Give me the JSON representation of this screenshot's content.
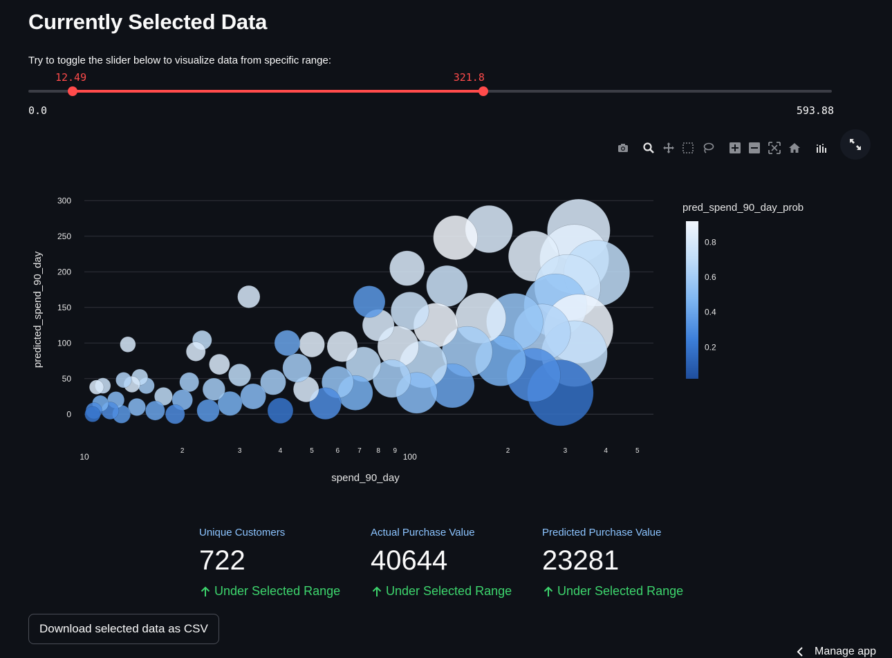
{
  "page": {
    "title": "Currently Selected Data",
    "instruction": "Try to toggle the slider below to visualize data from specific range:"
  },
  "slider": {
    "min": 0.0,
    "max": 593.88,
    "min_label": "0.0",
    "max_label": "593.88",
    "low": 12.49,
    "high": 321.8,
    "low_label": "12.49",
    "high_label": "321.8",
    "accent": "#ff4b4b"
  },
  "modebar": {
    "icons": [
      "camera-icon",
      "zoom-icon",
      "pan-icon",
      "box-select-icon",
      "lasso-select-icon",
      "zoom-in-icon",
      "zoom-out-icon",
      "autoscale-icon",
      "reset-axes-icon",
      "plotly-logo-icon"
    ],
    "fullscreen_icon": "expand-icon"
  },
  "chart_data": {
    "type": "scatter",
    "subtype": "bubble",
    "xlabel": "spend_90_day",
    "ylabel": "predicted_spend_90_day",
    "x_scale": "log",
    "xlim": [
      10,
      560
    ],
    "ylim": [
      -25,
      310
    ],
    "x_ticks_major": [
      {
        "value": 10,
        "label": "10"
      },
      {
        "value": 100,
        "label": "100"
      }
    ],
    "x_ticks_minor": [
      {
        "value": 20,
        "label": "2"
      },
      {
        "value": 30,
        "label": "3"
      },
      {
        "value": 40,
        "label": "4"
      },
      {
        "value": 50,
        "label": "5"
      },
      {
        "value": 60,
        "label": "6"
      },
      {
        "value": 70,
        "label": "7"
      },
      {
        "value": 80,
        "label": "8"
      },
      {
        "value": 90,
        "label": "9"
      },
      {
        "value": 200,
        "label": "2"
      },
      {
        "value": 300,
        "label": "3"
      },
      {
        "value": 400,
        "label": "4"
      },
      {
        "value": 500,
        "label": "5"
      }
    ],
    "y_ticks": [
      0,
      50,
      100,
      150,
      200,
      250,
      300
    ],
    "grid": true,
    "colorbar": {
      "title": "pred_spend_90_day_prob",
      "ticks": [
        0.2,
        0.4,
        0.6,
        0.8
      ],
      "range": [
        0.02,
        0.92
      ],
      "colors": [
        "#1f4e9c",
        "#3d7fd9",
        "#7eb6f2",
        "#bfdcf8",
        "#f2f7fd"
      ]
    },
    "points": [
      {
        "x": 330,
        "y": 258,
        "p": 0.82,
        "s": 0.9
      },
      {
        "x": 320,
        "y": 218,
        "p": 0.85,
        "s": 1.0
      },
      {
        "x": 375,
        "y": 198,
        "p": 0.7,
        "s": 0.95
      },
      {
        "x": 240,
        "y": 222,
        "p": 0.85,
        "s": 0.7
      },
      {
        "x": 175,
        "y": 260,
        "p": 0.82,
        "s": 0.65
      },
      {
        "x": 138,
        "y": 248,
        "p": 0.92,
        "s": 0.6
      },
      {
        "x": 305,
        "y": 178,
        "p": 0.75,
        "s": 0.95
      },
      {
        "x": 280,
        "y": 153,
        "p": 0.55,
        "s": 0.9
      },
      {
        "x": 330,
        "y": 120,
        "p": 0.9,
        "s": 1.0
      },
      {
        "x": 320,
        "y": 85,
        "p": 0.7,
        "s": 0.95
      },
      {
        "x": 290,
        "y": 30,
        "p": 0.18,
        "s": 0.95
      },
      {
        "x": 255,
        "y": 115,
        "p": 0.65,
        "s": 0.8
      },
      {
        "x": 240,
        "y": 55,
        "p": 0.3,
        "s": 0.75
      },
      {
        "x": 210,
        "y": 130,
        "p": 0.55,
        "s": 0.8
      },
      {
        "x": 190,
        "y": 75,
        "p": 0.45,
        "s": 0.7
      },
      {
        "x": 165,
        "y": 135,
        "p": 0.85,
        "s": 0.7
      },
      {
        "x": 150,
        "y": 88,
        "p": 0.6,
        "s": 0.7
      },
      {
        "x": 135,
        "y": 40,
        "p": 0.4,
        "s": 0.6
      },
      {
        "x": 130,
        "y": 180,
        "p": 0.75,
        "s": 0.55
      },
      {
        "x": 120,
        "y": 125,
        "p": 0.9,
        "s": 0.6
      },
      {
        "x": 110,
        "y": 70,
        "p": 0.7,
        "s": 0.65
      },
      {
        "x": 105,
        "y": 30,
        "p": 0.5,
        "s": 0.55
      },
      {
        "x": 98,
        "y": 205,
        "p": 0.82,
        "s": 0.45
      },
      {
        "x": 100,
        "y": 145,
        "p": 0.75,
        "s": 0.5
      },
      {
        "x": 92,
        "y": 95,
        "p": 0.85,
        "s": 0.55
      },
      {
        "x": 88,
        "y": 50,
        "p": 0.6,
        "s": 0.5
      },
      {
        "x": 80,
        "y": 125,
        "p": 0.82,
        "s": 0.4
      },
      {
        "x": 75,
        "y": 158,
        "p": 0.35,
        "s": 0.4
      },
      {
        "x": 72,
        "y": 70,
        "p": 0.7,
        "s": 0.45
      },
      {
        "x": 68,
        "y": 30,
        "p": 0.45,
        "s": 0.45
      },
      {
        "x": 62,
        "y": 95,
        "p": 0.85,
        "s": 0.38
      },
      {
        "x": 60,
        "y": 45,
        "p": 0.55,
        "s": 0.4
      },
      {
        "x": 55,
        "y": 15,
        "p": 0.3,
        "s": 0.4
      },
      {
        "x": 50,
        "y": 98,
        "p": 0.85,
        "s": 0.3
      },
      {
        "x": 48,
        "y": 35,
        "p": 0.82,
        "s": 0.3
      },
      {
        "x": 45,
        "y": 65,
        "p": 0.6,
        "s": 0.35
      },
      {
        "x": 42,
        "y": 100,
        "p": 0.4,
        "s": 0.3
      },
      {
        "x": 40,
        "y": 5,
        "p": 0.2,
        "s": 0.3
      },
      {
        "x": 38,
        "y": 45,
        "p": 0.6,
        "s": 0.3
      },
      {
        "x": 33,
        "y": 25,
        "p": 0.5,
        "s": 0.3
      },
      {
        "x": 32,
        "y": 165,
        "p": 0.8,
        "s": 0.25
      },
      {
        "x": 30,
        "y": 55,
        "p": 0.7,
        "s": 0.25
      },
      {
        "x": 28,
        "y": 15,
        "p": 0.45,
        "s": 0.28
      },
      {
        "x": 26,
        "y": 70,
        "p": 0.82,
        "s": 0.22
      },
      {
        "x": 25,
        "y": 35,
        "p": 0.6,
        "s": 0.25
      },
      {
        "x": 24,
        "y": 5,
        "p": 0.35,
        "s": 0.25
      },
      {
        "x": 23,
        "y": 104,
        "p": 0.7,
        "s": 0.2
      },
      {
        "x": 22,
        "y": 88,
        "p": 0.82,
        "s": 0.2
      },
      {
        "x": 21,
        "y": 45,
        "p": 0.6,
        "s": 0.2
      },
      {
        "x": 20,
        "y": 20,
        "p": 0.5,
        "s": 0.22
      },
      {
        "x": 19,
        "y": 0,
        "p": 0.3,
        "s": 0.2
      },
      {
        "x": 17.5,
        "y": 25,
        "p": 0.7,
        "s": 0.18
      },
      {
        "x": 16.5,
        "y": 5,
        "p": 0.4,
        "s": 0.2
      },
      {
        "x": 15.5,
        "y": 40,
        "p": 0.6,
        "s": 0.15
      },
      {
        "x": 14.8,
        "y": 52,
        "p": 0.7,
        "s": 0.15
      },
      {
        "x": 14.5,
        "y": 10,
        "p": 0.5,
        "s": 0.17
      },
      {
        "x": 14,
        "y": 42,
        "p": 0.8,
        "s": 0.15
      },
      {
        "x": 13.6,
        "y": 98,
        "p": 0.8,
        "s": 0.14
      },
      {
        "x": 13.2,
        "y": 48,
        "p": 0.65,
        "s": 0.14
      },
      {
        "x": 13,
        "y": 0,
        "p": 0.35,
        "s": 0.18
      },
      {
        "x": 12.5,
        "y": 20,
        "p": 0.5,
        "s": 0.16
      },
      {
        "x": 12,
        "y": 5,
        "p": 0.3,
        "s": 0.17
      },
      {
        "x": 11.4,
        "y": 40,
        "p": 0.75,
        "s": 0.14
      },
      {
        "x": 11.2,
        "y": 15,
        "p": 0.45,
        "s": 0.15
      },
      {
        "x": 10.9,
        "y": 38,
        "p": 0.82,
        "s": 0.12
      },
      {
        "x": 10.7,
        "y": 5,
        "p": 0.3,
        "s": 0.15
      },
      {
        "x": 10.6,
        "y": 0,
        "p": 0.2,
        "s": 0.14
      }
    ]
  },
  "metrics": [
    {
      "label": "Unique Customers",
      "value": "722",
      "delta": "Under Selected Range"
    },
    {
      "label": "Actual Purchase Value",
      "value": "40644",
      "delta": "Under Selected Range"
    },
    {
      "label": "Predicted Purchase Value",
      "value": "23281",
      "delta": "Under Selected Range"
    }
  ],
  "download_button": {
    "label": "Download selected data as CSV"
  },
  "manage_app": {
    "label": "Manage app",
    "icon": "chevron-left-icon"
  },
  "colors": {
    "background": "#0e1117",
    "metric_label": "#8cc4ff",
    "delta_positive": "#3dd56d"
  }
}
